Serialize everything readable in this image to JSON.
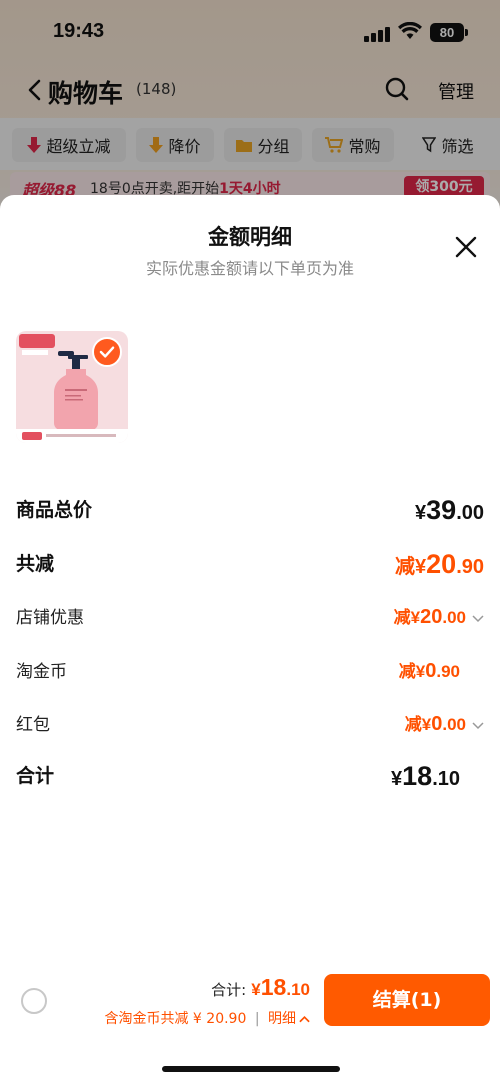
{
  "status_bar": {
    "time": "19:43",
    "battery": "80"
  },
  "nav": {
    "title": "购物车",
    "count": "(148)",
    "manage": "管理"
  },
  "filters": [
    {
      "label": "超级立减",
      "icon": "arrow-down-red-icon"
    },
    {
      "label": "降价",
      "icon": "arrow-down-orange-icon"
    },
    {
      "label": "分组",
      "icon": "folder-icon"
    },
    {
      "label": "常购",
      "icon": "cart-icon"
    },
    {
      "label": "筛选",
      "icon": "filter-icon"
    }
  ],
  "promo": {
    "logo": "超级88",
    "text_prefix": "18号0点开卖,距开始",
    "text_highlight": "1天4小时",
    "button": "领300元"
  },
  "sheet": {
    "title": "金额明细",
    "subtitle": "实际优惠金额请以下单页为准",
    "rows": {
      "total_price": {
        "label": "商品总价",
        "currency": "¥",
        "int": "39",
        "dec": ".00"
      },
      "total_discount": {
        "label": "共减",
        "prefix": "减",
        "currency": "¥",
        "int": "20",
        "dec": ".90"
      },
      "store_discount": {
        "label": "店铺优惠",
        "prefix": "减",
        "currency": "¥",
        "int": "20",
        "dec": ".00"
      },
      "taojinbi": {
        "label": "淘金币",
        "prefix": "减",
        "currency": "¥",
        "int": "0",
        "dec": ".90"
      },
      "red_packet": {
        "label": "红包",
        "prefix": "减",
        "currency": "¥",
        "int": "0",
        "dec": ".00"
      },
      "sum": {
        "label": "合计",
        "currency": "¥",
        "int": "18",
        "dec": ".10"
      }
    }
  },
  "bottom": {
    "total_label": "合计:",
    "total_currency": "¥",
    "total_int": "18",
    "total_dec": ".10",
    "discount_text": "含淘金币共减 ¥ 20.90",
    "separator": "|",
    "detail_link": "明细",
    "checkout": "结算(1)"
  },
  "colors": {
    "accent": "#ff5000",
    "button": "#ff5a00",
    "promo_red": "#e0284a"
  }
}
